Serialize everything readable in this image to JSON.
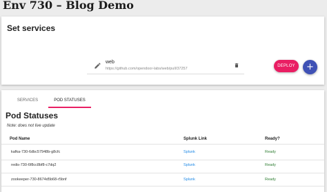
{
  "header": {
    "title": "Env 730 – Blog Demo"
  },
  "services": {
    "title": "Set services",
    "items": [
      {
        "name": "web",
        "url": "https://github.com/opendoor-labs/web/pull/37257",
        "edit_icon": "pencil-icon",
        "delete_icon": "trash-icon"
      }
    ],
    "deploy_label": "DEPLOY",
    "add_label": "+"
  },
  "tabs": [
    {
      "label": "SERVICES",
      "active": false
    },
    {
      "label": "POD STATUSES",
      "active": true
    }
  ],
  "pods": {
    "title": "Pod Statuses",
    "note": "Note: does not live update",
    "columns": [
      "Pod Name",
      "Splunk Link",
      "Ready?"
    ],
    "rows": [
      {
        "name": "kafka-730-6dbc57948b-g8cfc",
        "link": "Splunk",
        "ready": "Ready"
      },
      {
        "name": "redis-730-6f8cc8bf8-c7dq2",
        "link": "Splunk",
        "ready": "Ready"
      },
      {
        "name": "zookeeper-730-8674d5b68-r5bnf",
        "link": "Splunk",
        "ready": "Ready"
      }
    ]
  },
  "colors": {
    "deploy": "#e91e63",
    "add": "#3f51b5",
    "link": "#1e88e5",
    "ready": "#2e7d32",
    "tab_indicator": "#e91e63"
  }
}
